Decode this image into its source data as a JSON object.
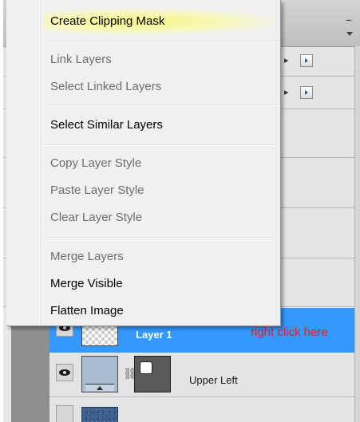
{
  "context_menu": {
    "items": [
      {
        "label": "Create Clipping Mask",
        "enabled": true
      },
      {
        "label": "Link Layers",
        "enabled": false
      },
      {
        "label": "Select Linked Layers",
        "enabled": false
      },
      {
        "label": "Select Similar Layers",
        "enabled": true
      },
      {
        "label": "Copy Layer Style",
        "enabled": false
      },
      {
        "label": "Paste Layer Style",
        "enabled": false
      },
      {
        "label": "Clear Layer Style",
        "enabled": false
      },
      {
        "label": "Merge Layers",
        "enabled": false
      },
      {
        "label": "Merge Visible",
        "enabled": true
      },
      {
        "label": "Flatten Image",
        "enabled": true
      }
    ],
    "highlight_color": "#f5f57a"
  },
  "layers_panel": {
    "minimize_glyph": "–",
    "layers": [
      {
        "name": "Layer 1",
        "selected": true
      },
      {
        "name": "Upper Left",
        "selected": false
      }
    ],
    "selection_color": "#3399ff"
  },
  "annotation": {
    "text": "right click here",
    "color": "#e02020"
  }
}
